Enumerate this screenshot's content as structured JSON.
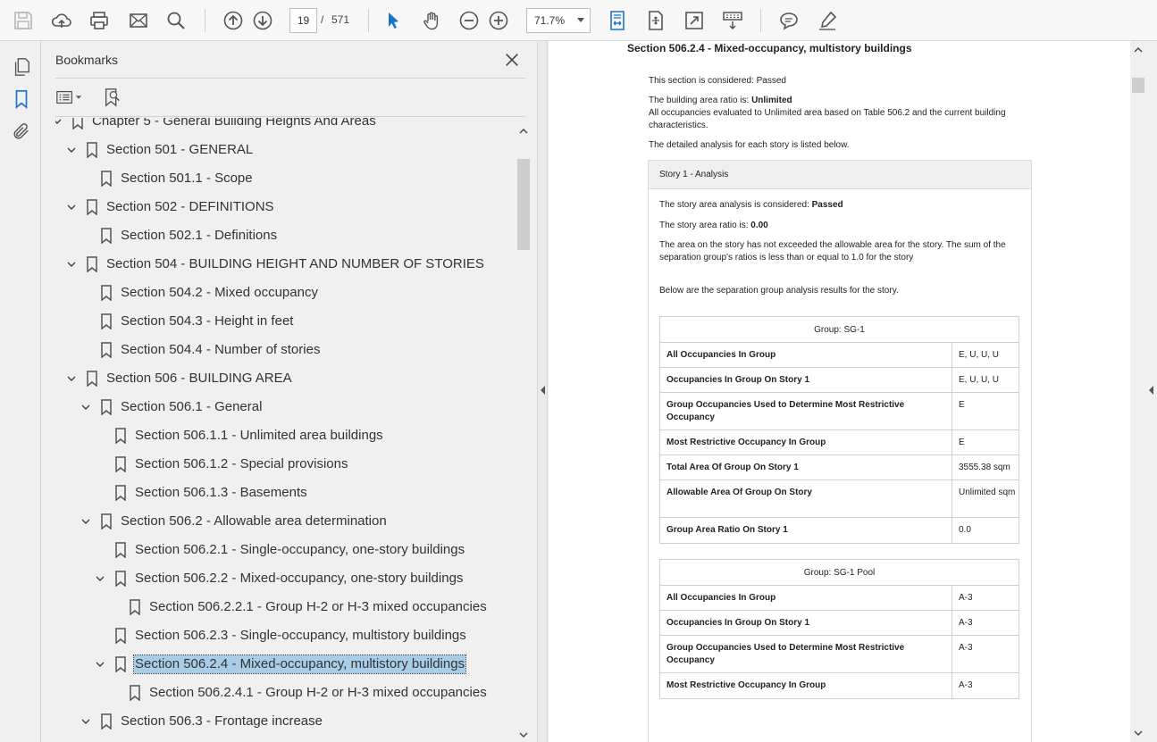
{
  "toolbar": {
    "page_current": "19",
    "page_sep": "/",
    "page_total": "571",
    "zoom": "71.7%",
    "accent": "#1a73c9"
  },
  "bookmarks": {
    "title": "Bookmarks",
    "items": [
      {
        "label": "Chapter 5 - General Building Heights And Areas",
        "level": 0,
        "expanded": true
      },
      {
        "label": "Section 501 - GENERAL",
        "level": 1,
        "expanded": true
      },
      {
        "label": "Section 501.1 - Scope",
        "level": 2
      },
      {
        "label": "Section 502 - DEFINITIONS",
        "level": 1,
        "expanded": true
      },
      {
        "label": "Section 502.1 - Definitions",
        "level": 2
      },
      {
        "label": "Section 504 - BUILDING HEIGHT AND NUMBER OF STORIES",
        "level": 1,
        "expanded": true
      },
      {
        "label": "Section 504.2 - Mixed occupancy",
        "level": 2
      },
      {
        "label": "Section 504.3 - Height in feet",
        "level": 2
      },
      {
        "label": "Section 504.4 - Number of stories",
        "level": 2
      },
      {
        "label": "Section 506 - BUILDING AREA",
        "level": 1,
        "expanded": true
      },
      {
        "label": "Section 506.1 - General",
        "level": 2,
        "expanded": true
      },
      {
        "label": "Section 506.1.1 - Unlimited area buildings",
        "level": 3
      },
      {
        "label": "Section 506.1.2 - Special provisions",
        "level": 3
      },
      {
        "label": "Section 506.1.3 - Basements",
        "level": 3
      },
      {
        "label": "Section 506.2 - Allowable area determination",
        "level": 2,
        "expanded": true
      },
      {
        "label": "Section 506.2.1 - Single-occupancy, one-story buildings",
        "level": 3
      },
      {
        "label": "Section 506.2.2 - Mixed-occupancy, one-story buildings",
        "level": 3,
        "expanded": true
      },
      {
        "label": "Section 506.2.2.1 - Group H-2 or H-3 mixed occupancies",
        "level": 4
      },
      {
        "label": "Section 506.2.3 - Single-occupancy, multistory buildings",
        "level": 3
      },
      {
        "label": "Section 506.2.4 - Mixed-occupancy, multistory buildings",
        "level": 3,
        "expanded": true,
        "selected": true
      },
      {
        "label": "Section 506.2.4.1 - Group H-2 or H-3 mixed occupancies",
        "level": 4
      },
      {
        "label": "Section 506.3 - Frontage increase",
        "level": 2,
        "expanded": true
      }
    ]
  },
  "doc": {
    "heading": "Section 506.2.4 - Mixed-occupancy, multistory buildings",
    "considered_prefix": "This section is considered: ",
    "considered_value": "Passed",
    "ratio_prefix": "The building area ratio is: ",
    "ratio_value": "Unlimited",
    "ratio_note": "All occupancies evaluated to Unlimited area based on Table 506.2 and the current building characteristics.",
    "detail_note": "The detailed analysis for each story is listed below.",
    "story": {
      "title": "Story 1 - Analysis",
      "considered_prefix": "The story area analysis is considered: ",
      "considered_value": "Passed",
      "ratio_prefix": "The story area ratio is: ",
      "ratio_value": "0.00",
      "note": "The area on the story has not exceeded the allowable area for the story. The sum of the separation group's ratios is less than or equal to 1.0 for the story",
      "below": "Below are the separation group analysis results for the story.",
      "groups": [
        {
          "title": "Group: SG-1",
          "rows": [
            {
              "k": "All Occupancies In Group",
              "v": "E, U, U, U"
            },
            {
              "k": "Occupancies In Group On Story 1",
              "v": "E, U, U, U"
            },
            {
              "k": "Group Occupancies Used to Determine Most Restrictive Occupancy",
              "v": "E"
            },
            {
              "k": "Most Restrictive Occupancy In Group",
              "v": "E"
            },
            {
              "k": "Total Area Of Group On Story 1",
              "v": "3555.38 sqm"
            },
            {
              "k": "Allowable Area Of Group On Story",
              "v": "Unlimited sqm"
            },
            {
              "k": "Group Area Ratio On Story 1",
              "v": "0.0"
            }
          ]
        },
        {
          "title": "Group: SG-1 Pool",
          "rows": [
            {
              "k": "All Occupancies In Group",
              "v": "A-3"
            },
            {
              "k": "Occupancies In Group On Story 1",
              "v": "A-3"
            },
            {
              "k": "Group Occupancies Used to Determine Most Restrictive Occupancy",
              "v": "A-3"
            },
            {
              "k": "Most Restrictive Occupancy In Group",
              "v": "A-3"
            }
          ]
        }
      ]
    }
  }
}
